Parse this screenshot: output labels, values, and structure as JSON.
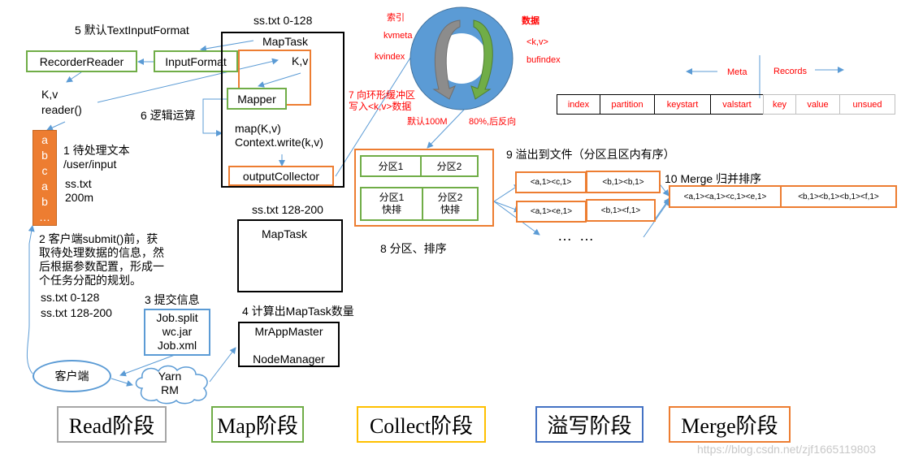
{
  "steps": {
    "step5": "5 默认TextInputFormat",
    "step6": "6 逻辑运算",
    "step7_line1": "7 向环形缓冲区",
    "step7_line2": "写入<k,v>数据",
    "step1_title": "1 待处理文本",
    "step1_path": "/user/input",
    "step1_file": "ss.txt",
    "step1_size": "200m",
    "step2_lines": [
      "2 客户端submit()前，获",
      "取待处理数据的信息，然",
      "后根据参数配置，形成一",
      "个任务分配的规划。"
    ],
    "step2_splits": [
      "ss.txt  0-128",
      "ss.txt  128-200"
    ],
    "step3": "3 提交信息",
    "step4": "4 计算出MapTask数量",
    "step8": "8 分区、排序",
    "step9": "9 溢出到文件（分区且区内有序）",
    "step10": "10 Merge 归并排序"
  },
  "read": {
    "recorder_reader": "RecorderReader",
    "input_format": "InputFormat",
    "kv_label": "K,v",
    "reader_call": "reader()"
  },
  "input_column": [
    "a",
    "b",
    "c",
    "a",
    "b",
    "…"
  ],
  "maptask1": {
    "split_label": "ss.txt 0-128",
    "title": "MapTask",
    "kv": "K,v",
    "mapper": "Mapper",
    "map_call": "map(K,v)",
    "context_write": "Context.write(k,v)",
    "output_collector": "outputCollector"
  },
  "maptask2": {
    "split_label": "ss.txt 128-200",
    "title": "MapTask"
  },
  "job_files": [
    "Job.split",
    "wc.jar",
    "Job.xml"
  ],
  "client": "客户端",
  "yarn": [
    "Yarn",
    "RM"
  ],
  "appmaster": [
    "MrAppMaster",
    "NodeManager"
  ],
  "ring_buffer": {
    "index_title": "索引",
    "kvmeta": "kvmeta",
    "kvindex": "kvindex",
    "data_title": "数据",
    "kv": "<k,v>",
    "bufindex": "bufindex",
    "default_size": "默认100M",
    "threshold": "80%,后反向"
  },
  "meta_records": {
    "meta_label": "Meta",
    "records_label": "Records",
    "meta_cells": [
      "index",
      "partition",
      "keystart",
      "valstart"
    ],
    "record_cells": [
      "key",
      "value",
      "unsued"
    ]
  },
  "partitions": {
    "row1": [
      "分区1",
      "分区2"
    ],
    "row2": [
      [
        "分区1",
        "快排"
      ],
      [
        "分区2",
        "快排"
      ]
    ]
  },
  "spill_files": [
    [
      "<a,1><c,1>",
      "<b,1><b,1>"
    ],
    [
      "<a,1><e,1>",
      "<b,1><f,1>"
    ]
  ],
  "spill_more": "… …",
  "merge_result": [
    "<a,1><a,1><c,1><e,1>",
    "<b,1><b,1><b,1><f,1>"
  ],
  "legend": [
    {
      "label": "Read阶段",
      "color": "#a6a6a6"
    },
    {
      "label": "Map阶段",
      "color": "#70ad47"
    },
    {
      "label": "Collect阶段",
      "color": "#ffc000"
    },
    {
      "label": "溢写阶段",
      "color": "#4472c4"
    },
    {
      "label": "Merge阶段",
      "color": "#ed7d31"
    }
  ],
  "watermark": "https://blog.csdn.net/zjf1665119803"
}
